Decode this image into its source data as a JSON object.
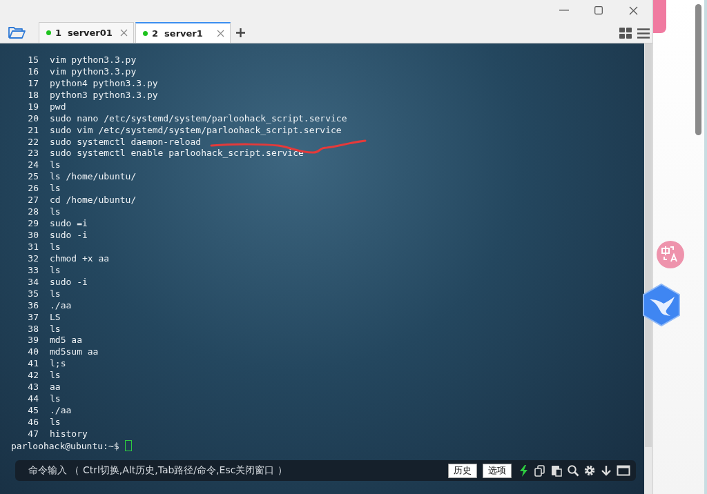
{
  "tabs": [
    {
      "label": "1  server01",
      "selected": false,
      "connected": true
    },
    {
      "label": "2  server1",
      "selected": true,
      "connected": true
    }
  ],
  "terminal": {
    "history": [
      {
        "n": "15",
        "cmd": "vim python3.3.py"
      },
      {
        "n": "16",
        "cmd": "vim python3.3.py"
      },
      {
        "n": "17",
        "cmd": "python4 python3.3.py"
      },
      {
        "n": "18",
        "cmd": "python3 python3.3.py"
      },
      {
        "n": "19",
        "cmd": "pwd"
      },
      {
        "n": "20",
        "cmd": "sudo nano /etc/systemd/system/parloohack_script.service"
      },
      {
        "n": "21",
        "cmd": "sudo vim /etc/systemd/system/parloohack_script.service"
      },
      {
        "n": "22",
        "cmd": "sudo systemctl daemon-reload"
      },
      {
        "n": "23",
        "cmd": "sudo systemctl enable parloohack_script.service"
      },
      {
        "n": "24",
        "cmd": "ls"
      },
      {
        "n": "25",
        "cmd": "ls /home/ubuntu/"
      },
      {
        "n": "26",
        "cmd": "ls"
      },
      {
        "n": "27",
        "cmd": "cd /home/ubuntu/"
      },
      {
        "n": "28",
        "cmd": "ls"
      },
      {
        "n": "29",
        "cmd": "sudo =i"
      },
      {
        "n": "30",
        "cmd": "sudo -i"
      },
      {
        "n": "31",
        "cmd": "ls"
      },
      {
        "n": "32",
        "cmd": "chmod +x aa"
      },
      {
        "n": "33",
        "cmd": "ls"
      },
      {
        "n": "34",
        "cmd": "sudo -i"
      },
      {
        "n": "35",
        "cmd": "ls"
      },
      {
        "n": "36",
        "cmd": "./aa"
      },
      {
        "n": "37",
        "cmd": "LS"
      },
      {
        "n": "38",
        "cmd": "ls"
      },
      {
        "n": "39",
        "cmd": "md5 aa"
      },
      {
        "n": "40",
        "cmd": "md5sum aa"
      },
      {
        "n": "41",
        "cmd": "l;s"
      },
      {
        "n": "42",
        "cmd": "ls"
      },
      {
        "n": "43",
        "cmd": "aa"
      },
      {
        "n": "44",
        "cmd": "ls"
      },
      {
        "n": "45",
        "cmd": "./aa"
      },
      {
        "n": "46",
        "cmd": "ls"
      },
      {
        "n": "47",
        "cmd": "history"
      }
    ],
    "prompt": "parloohack@ubuntu:~$"
  },
  "command_bar": {
    "hint": "命令输入 （ Ctrl切换,Alt历史,Tab路径/命令,Esc关闭窗口 ）",
    "buttons": [
      "历史",
      "选项"
    ]
  }
}
